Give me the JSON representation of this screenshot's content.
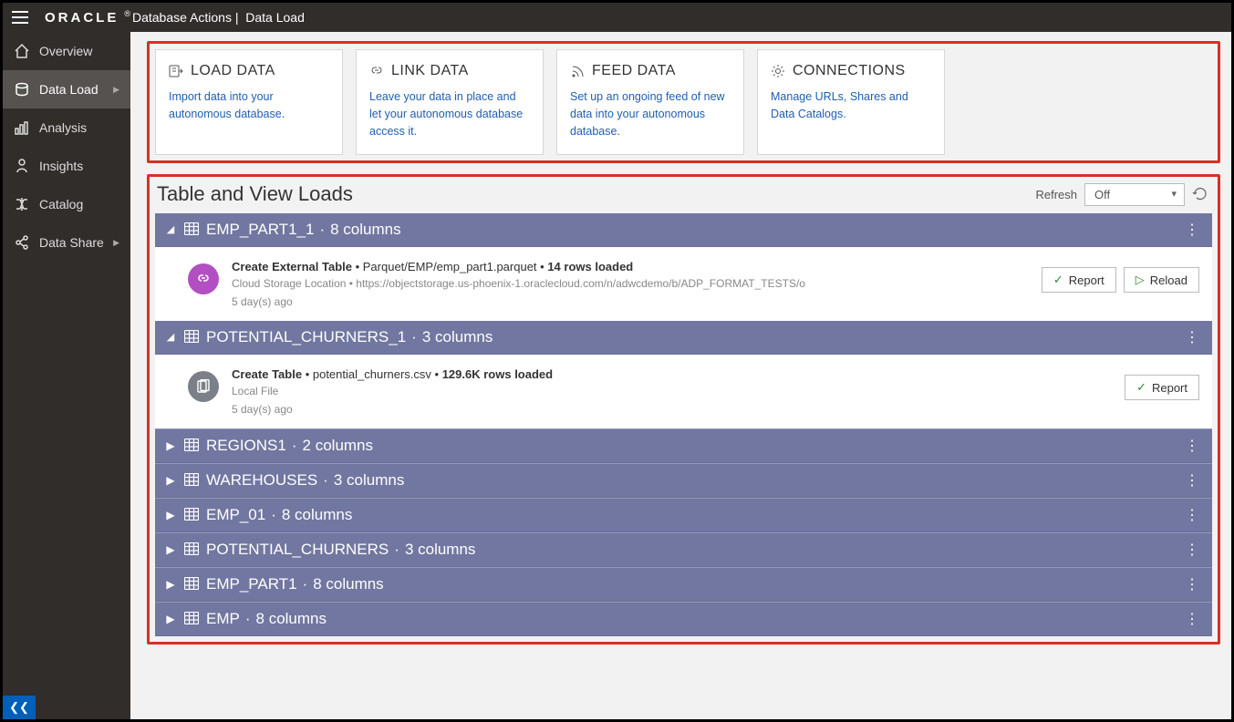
{
  "topbar": {
    "brand": "ORACLE",
    "product": "Database Actions",
    "page": "Data Load"
  },
  "sidebar": {
    "items": [
      {
        "label": "Overview",
        "icon": "home"
      },
      {
        "label": "Data Load",
        "icon": "load",
        "active": true,
        "expandable": true
      },
      {
        "label": "Analysis",
        "icon": "analysis"
      },
      {
        "label": "Insights",
        "icon": "insights"
      },
      {
        "label": "Catalog",
        "icon": "catalog"
      },
      {
        "label": "Data Share",
        "icon": "share",
        "expandable": true
      }
    ]
  },
  "cards": [
    {
      "title": "LOAD DATA",
      "desc": "Import data into your autonomous database.",
      "icon": "load"
    },
    {
      "title": "LINK DATA",
      "desc": "Leave your data in place and let your autonomous database access it.",
      "icon": "link"
    },
    {
      "title": "FEED DATA",
      "desc": "Set up an ongoing feed of new data into your autonomous database.",
      "icon": "feed"
    },
    {
      "title": "CONNECTIONS",
      "desc": "Manage URLs, Shares and Data Catalogs.",
      "icon": "conn"
    }
  ],
  "loads": {
    "title": "Table and View Loads",
    "refresh_label": "Refresh",
    "refresh_value": "Off",
    "report_label": "Report",
    "reload_label": "Reload",
    "items": [
      {
        "name": "EMP_PART1_1",
        "cols": "8 columns",
        "expanded": true,
        "detail": {
          "kind": "link",
          "l1a": "Create External Table",
          "l1b": "Parquet/EMP/emp_part1.parquet",
          "l1c": "14 rows loaded",
          "l2a": "Cloud Storage Location",
          "l2b": "https://objectstorage.us-phoenix-1.oraclecloud.com/n/adwcdemo/b/ADP_FORMAT_TESTS/o",
          "l3": "5 day(s) ago",
          "buttons": [
            "report",
            "reload"
          ]
        }
      },
      {
        "name": "POTENTIAL_CHURNERS_1",
        "cols": "3 columns",
        "expanded": true,
        "detail": {
          "kind": "file",
          "l1a": "Create Table",
          "l1b": "potential_churners.csv",
          "l1c": "129.6K rows loaded",
          "l2a": "Local File",
          "l2b": "",
          "l3": "5 day(s) ago",
          "buttons": [
            "report"
          ]
        }
      },
      {
        "name": "REGIONS1",
        "cols": "2 columns",
        "expanded": false
      },
      {
        "name": "WAREHOUSES",
        "cols": "3 columns",
        "expanded": false
      },
      {
        "name": "EMP_01",
        "cols": "8 columns",
        "expanded": false
      },
      {
        "name": "POTENTIAL_CHURNERS",
        "cols": "3 columns",
        "expanded": false
      },
      {
        "name": "EMP_PART1",
        "cols": "8 columns",
        "expanded": false
      },
      {
        "name": "EMP",
        "cols": "8 columns",
        "expanded": false
      }
    ]
  }
}
